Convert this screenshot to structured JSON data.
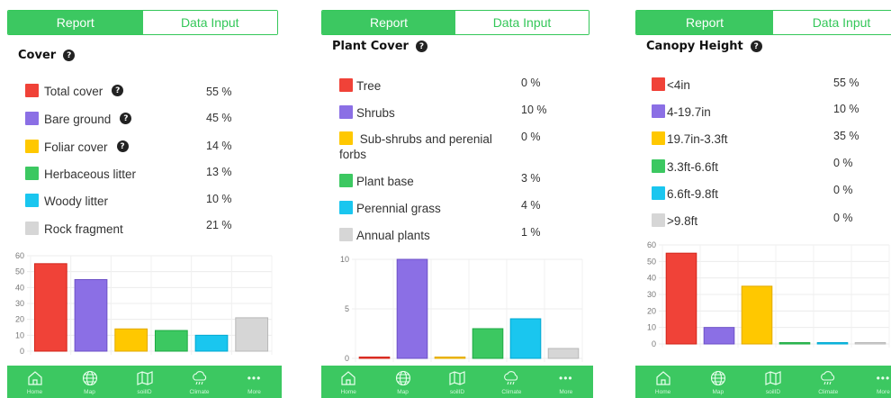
{
  "tabs": {
    "report": "Report",
    "data_input": "Data Input"
  },
  "nav": [
    {
      "label": "Home",
      "icon": "home-icon"
    },
    {
      "label": "Map",
      "icon": "globe-icon"
    },
    {
      "label": "soilID",
      "icon": "map-icon"
    },
    {
      "label": "Climate",
      "icon": "cloud-rain-icon"
    },
    {
      "label": "More",
      "icon": "more-icon"
    }
  ],
  "screens": [
    {
      "title": "Cover",
      "items": [
        {
          "label": "Total cover",
          "value": "55 %",
          "color": "#f04238",
          "help": true
        },
        {
          "label": "Bare ground",
          "value": "45 %",
          "color": "#8b6fe5",
          "help": true
        },
        {
          "label": "Foliar cover",
          "value": "14 %",
          "color": "#ffc800",
          "help": true
        },
        {
          "label": "Herbaceous litter",
          "value": "13 %",
          "color": "#3cc861",
          "help": false
        },
        {
          "label": "Woody litter",
          "value": "10 %",
          "color": "#1ac6ef",
          "help": false
        },
        {
          "label": "Rock fragment",
          "value": "21 %",
          "color": "#d6d6d6",
          "help": false
        }
      ]
    },
    {
      "title": "Plant Cover",
      "items": [
        {
          "label": "Tree",
          "value": "0 %",
          "color": "#f04238"
        },
        {
          "label": "Shrubs",
          "value": "10 %",
          "color": "#8b6fe5"
        },
        {
          "label": "Sub-shrubs and perenial forbs",
          "value": "0 %",
          "color": "#ffc800"
        },
        {
          "label": "Plant base",
          "value": "3 %",
          "color": "#3cc861"
        },
        {
          "label": "Perennial grass",
          "value": "4 %",
          "color": "#1ac6ef"
        },
        {
          "label": "Annual plants",
          "value": "1 %",
          "color": "#d6d6d6"
        }
      ]
    },
    {
      "title": "Canopy Height",
      "items": [
        {
          "label": "<4in",
          "value": "55 %",
          "color": "#f04238"
        },
        {
          "label": "4-19.7in",
          "value": "10 %",
          "color": "#8b6fe5"
        },
        {
          "label": "19.7in-3.3ft",
          "value": "35 %",
          "color": "#ffc800"
        },
        {
          "label": "3.3ft-6.6ft",
          "value": "0 %",
          "color": "#3cc861"
        },
        {
          "label": "6.6ft-9.8ft",
          "value": "0 %",
          "color": "#1ac6ef"
        },
        {
          "label": ">9.8ft",
          "value": "0 %",
          "color": "#d6d6d6"
        }
      ]
    }
  ],
  "chart_data": [
    {
      "type": "bar",
      "categories": [
        "Total cover",
        "Bare ground",
        "Foliar cover",
        "Herbaceous litter",
        "Woody litter",
        "Rock fragment"
      ],
      "values": [
        55,
        45,
        14,
        13,
        10,
        21
      ],
      "colors": [
        "#f04238",
        "#8b6fe5",
        "#ffc800",
        "#3cc861",
        "#1ac6ef",
        "#d6d6d6"
      ],
      "ylim": [
        0,
        60
      ],
      "yticks": [
        0,
        10,
        20,
        30,
        40,
        50,
        60
      ],
      "grid": true
    },
    {
      "type": "bar",
      "categories": [
        "Tree",
        "Shrubs",
        "Sub-shrubs and perenial forbs",
        "Plant base",
        "Perennial grass",
        "Annual plants"
      ],
      "values": [
        0,
        10,
        0,
        3,
        4,
        1
      ],
      "colors": [
        "#f04238",
        "#8b6fe5",
        "#ffc800",
        "#3cc861",
        "#1ac6ef",
        "#d6d6d6"
      ],
      "ylim": [
        0,
        10
      ],
      "yticks": [
        0,
        5,
        10
      ],
      "grid": true
    },
    {
      "type": "bar",
      "categories": [
        "<4in",
        "4-19.7in",
        "19.7in-3.3ft",
        "3.3ft-6.6ft",
        "6.6ft-9.8ft",
        ">9.8ft"
      ],
      "values": [
        55,
        10,
        35,
        0,
        0,
        0
      ],
      "colors": [
        "#f04238",
        "#8b6fe5",
        "#ffc800",
        "#3cc861",
        "#1ac6ef",
        "#d6d6d6"
      ],
      "ylim": [
        0,
        60
      ],
      "yticks": [
        0,
        10,
        20,
        30,
        40,
        50,
        60
      ],
      "grid": true
    }
  ]
}
